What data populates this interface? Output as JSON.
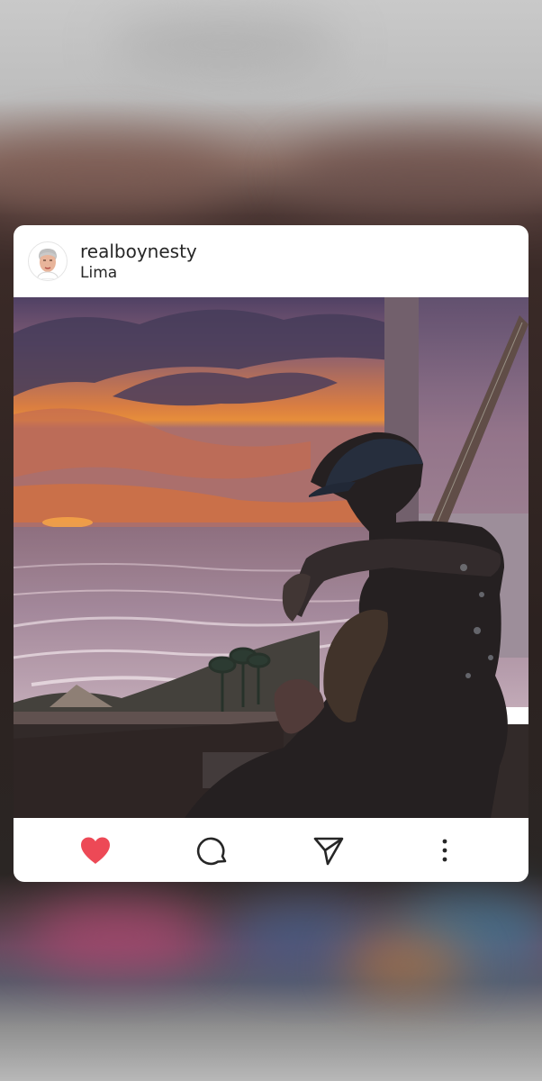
{
  "post": {
    "username": "realboynesty",
    "location": "Lima"
  },
  "photo": {
    "alt": "Person with cap and guitar sitting by a window overlooking the ocean at sunset"
  },
  "actions": {
    "like_icon": "heart-icon",
    "comment_icon": "comment-icon",
    "share_icon": "send-icon",
    "more_icon": "more-vertical-icon",
    "like_color": "#ed4956",
    "icon_color": "#262626"
  }
}
